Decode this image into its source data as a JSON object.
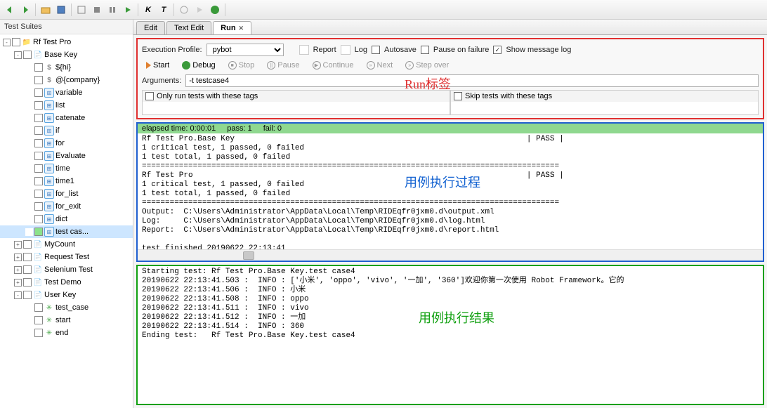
{
  "toolbar_icons": [
    "back",
    "forward",
    "open",
    "save",
    "run-suite",
    "stop",
    "pause",
    "play-green",
    "play-black",
    "k",
    "t",
    "step",
    "step-into",
    "bug"
  ],
  "sidebar": {
    "title": "Test Suites",
    "tree": [
      {
        "d": 0,
        "t": "-",
        "chk": false,
        "ic": "folder",
        "label": "Rf Test Pro"
      },
      {
        "d": 1,
        "t": "-",
        "chk": false,
        "ic": "file",
        "label": "Base Key"
      },
      {
        "d": 2,
        "t": "",
        "chk": false,
        "ic": "dollar",
        "label": "${hi}"
      },
      {
        "d": 2,
        "t": "",
        "chk": false,
        "ic": "dollar",
        "label": "@{company}"
      },
      {
        "d": 2,
        "t": "",
        "chk": false,
        "ic": "tc",
        "label": "variable"
      },
      {
        "d": 2,
        "t": "",
        "chk": false,
        "ic": "tc",
        "label": "list"
      },
      {
        "d": 2,
        "t": "",
        "chk": false,
        "ic": "tc",
        "label": "catenate"
      },
      {
        "d": 2,
        "t": "",
        "chk": false,
        "ic": "tc",
        "label": "if"
      },
      {
        "d": 2,
        "t": "",
        "chk": false,
        "ic": "tc",
        "label": "for"
      },
      {
        "d": 2,
        "t": "",
        "chk": false,
        "ic": "tc",
        "label": "Evaluate"
      },
      {
        "d": 2,
        "t": "",
        "chk": false,
        "ic": "tc",
        "label": "time"
      },
      {
        "d": 2,
        "t": "",
        "chk": false,
        "ic": "tc",
        "label": "time1"
      },
      {
        "d": 2,
        "t": "",
        "chk": false,
        "ic": "tc",
        "label": "for_list"
      },
      {
        "d": 2,
        "t": "",
        "chk": false,
        "ic": "tc",
        "label": "for_exit"
      },
      {
        "d": 2,
        "t": "",
        "chk": false,
        "ic": "tc",
        "label": "dict"
      },
      {
        "d": 2,
        "t": "",
        "chk": true,
        "ic": "tc",
        "label": "test cas...",
        "sel": true
      },
      {
        "d": 1,
        "t": "+",
        "chk": false,
        "ic": "file",
        "label": "MyCount"
      },
      {
        "d": 1,
        "t": "+",
        "chk": false,
        "ic": "file",
        "label": "Request Test"
      },
      {
        "d": 1,
        "t": "+",
        "chk": false,
        "ic": "file",
        "label": "Selenium Test"
      },
      {
        "d": 1,
        "t": "+",
        "chk": false,
        "ic": "file",
        "label": "Test Demo"
      },
      {
        "d": 1,
        "t": "-",
        "chk": false,
        "ic": "file",
        "label": "User Key"
      },
      {
        "d": 2,
        "t": "",
        "chk": false,
        "ic": "gear",
        "label": "test_case"
      },
      {
        "d": 2,
        "t": "",
        "chk": false,
        "ic": "gear",
        "label": "start"
      },
      {
        "d": 2,
        "t": "",
        "chk": false,
        "ic": "gear",
        "label": "end"
      }
    ]
  },
  "tabs": {
    "items": [
      "Edit",
      "Text Edit",
      "Run"
    ],
    "active": 2
  },
  "run": {
    "profile_label": "Execution Profile:",
    "profile_value": "pybot",
    "report": "Report",
    "log": "Log",
    "autosave": "Autosave",
    "pause_fail": "Pause on failure",
    "show_msg": "Show message log",
    "start": "Start",
    "debug": "Debug",
    "stop": "Stop",
    "pause": "Pause",
    "cont": "Continue",
    "next": "Next",
    "stepover": "Step over",
    "args_label": "Arguments:",
    "args_value": "-t testcase4",
    "only_tags": "Only run tests with these tags",
    "skip_tags": "Skip tests with these tags",
    "annot": "Run标签"
  },
  "status": {
    "elapsed_label": "elapsed time:",
    "elapsed": "0:00:01",
    "pass_label": "pass:",
    "pass": "1",
    "fail_label": "fail:",
    "fail": "0"
  },
  "exec_log": "Rf Test Pro.Base Key                                                               | PASS |\n1 critical test, 1 passed, 0 failed\n1 test total, 1 passed, 0 failed\n==========================================================================================\nRf Test Pro                                                                        | PASS |\n1 critical test, 1 passed, 0 failed\n1 test total, 1 passed, 0 failed\n==========================================================================================\nOutput:  C:\\Users\\Administrator\\AppData\\Local\\Temp\\RIDEqfr0jxm0.d\\output.xml\nLog:     C:\\Users\\Administrator\\AppData\\Local\\Temp\\RIDEqfr0jxm0.d\\log.html\nReport:  C:\\Users\\Administrator\\AppData\\Local\\Temp\\RIDEqfr0jxm0.d\\report.html\n\ntest finished 20190622 22:13:41",
  "exec_annot": "用例执行过程",
  "result_log": "Starting test: Rf Test Pro.Base Key.test case4\n20190622 22:13:41.503 :  INFO : ['小米', 'oppo', 'vivo', '一加', '360']欢迎你第一次使用 Robot Framework。它的\n20190622 22:13:41.506 :  INFO : 小米\n20190622 22:13:41.508 :  INFO : oppo\n20190622 22:13:41.511 :  INFO : vivo\n20190622 22:13:41.512 :  INFO : 一加\n20190622 22:13:41.514 :  INFO : 360\nEnding test:   Rf Test Pro.Base Key.test case4",
  "result_annot": "用例执行结果"
}
